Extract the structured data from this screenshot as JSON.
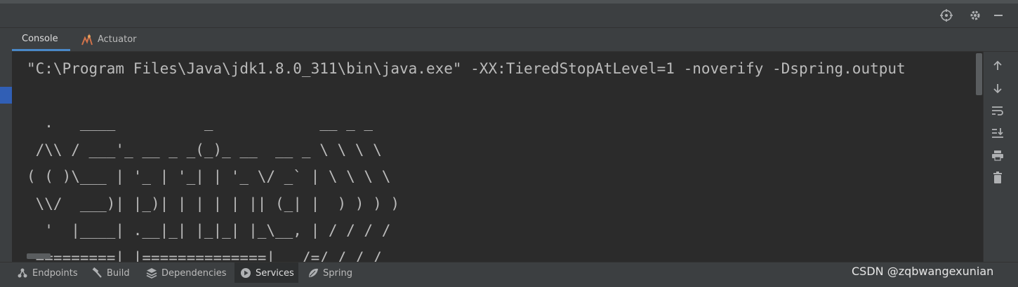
{
  "header": {
    "icons": [
      "crosshair-icon",
      "gear-icon",
      "minimize-icon"
    ]
  },
  "tabs": [
    {
      "label": "Console",
      "active": true
    },
    {
      "label": "Actuator",
      "active": false,
      "icon": "actuator-icon"
    }
  ],
  "console": {
    "lines": [
      "\"C:\\Program Files\\Java\\jdk1.8.0_311\\bin\\java.exe\" -XX:TieredStopAtLevel=1 -noverify -Dspring.output",
      "",
      "  .   ____          _            __ _ _",
      " /\\\\ / ___'_ __ _ _(_)_ __  __ _ \\ \\ \\ \\",
      "( ( )\\___ | '_ | '_| | '_ \\/ _` | \\ \\ \\ \\",
      " \\\\/  ___)| |_)| | | | | || (_| |  ) ) ) )",
      "  '  |____| .__|_| |_|_| |_\\__, | / / / /",
      " =========|_|==============|___/=/_/_/_/"
    ]
  },
  "right_toolbar": {
    "icons": [
      "arrow-up-icon",
      "arrow-down-icon",
      "soft-wrap-icon",
      "scroll-to-end-icon",
      "print-icon",
      "trash-icon"
    ]
  },
  "bottom_tabs": [
    {
      "label": "Endpoints",
      "icon": "endpoints-icon",
      "active": false
    },
    {
      "label": "Build",
      "icon": "hammer-icon",
      "active": false
    },
    {
      "label": "Dependencies",
      "icon": "dependencies-icon",
      "active": false
    },
    {
      "label": "Services",
      "icon": "services-icon",
      "active": true
    },
    {
      "label": "Spring",
      "icon": "spring-icon",
      "active": false
    }
  ],
  "watermark": "CSDN @zqbwangexunian",
  "colors": {
    "background": "#2b2b2b",
    "panel": "#3c3f41",
    "text": "#bbbbbb",
    "accent": "#4a88c7"
  }
}
